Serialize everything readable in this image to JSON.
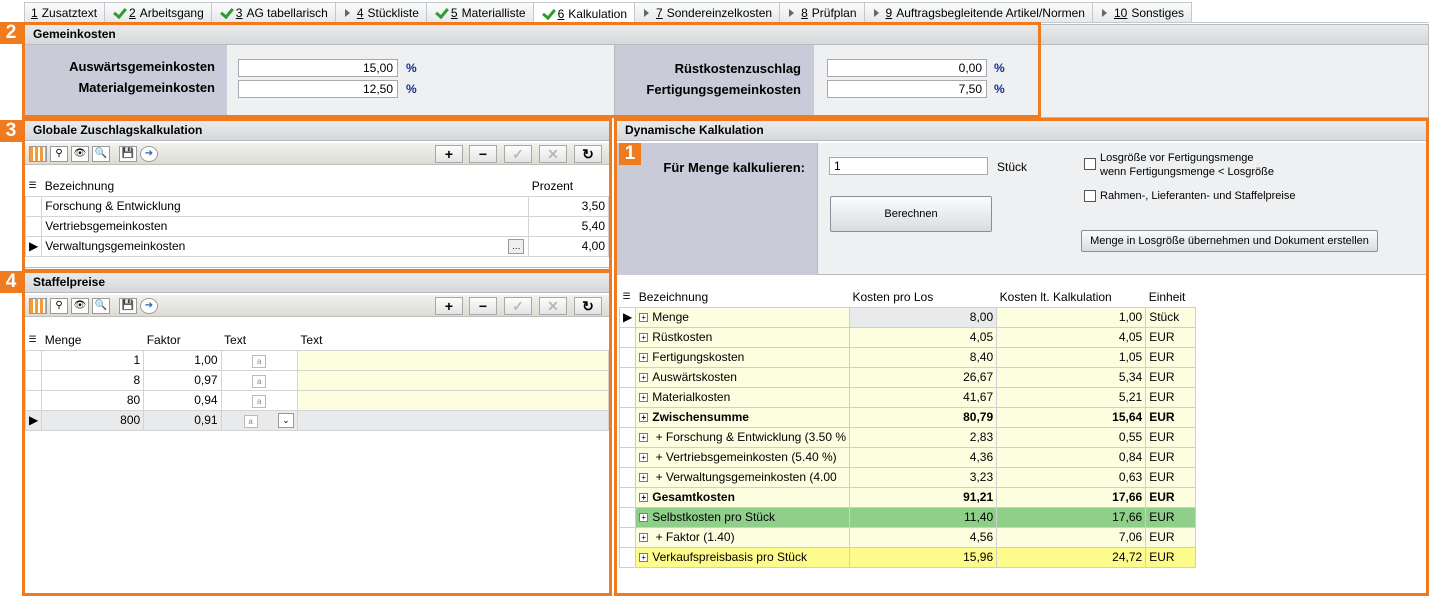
{
  "tabs": [
    {
      "num": "1",
      "label": "Zusatztext",
      "icon": "none"
    },
    {
      "num": "2",
      "label": "Arbeitsgang",
      "icon": "check"
    },
    {
      "num": "3",
      "label": "AG tabellarisch",
      "icon": "check"
    },
    {
      "num": "4",
      "label": "Stückliste",
      "icon": "arrow"
    },
    {
      "num": "5",
      "label": "Materialliste",
      "icon": "check"
    },
    {
      "num": "6",
      "label": "Kalkulation",
      "icon": "check",
      "active": true
    },
    {
      "num": "7",
      "label": "Sondereinzelkosten",
      "icon": "arrow"
    },
    {
      "num": "8",
      "label": "Prüfplan",
      "icon": "arrow"
    },
    {
      "num": "9",
      "label": "Auftragsbegleitende Artikel/Normen",
      "icon": "arrow"
    },
    {
      "num": "10",
      "label": "Sonstiges",
      "icon": "arrow"
    }
  ],
  "badges": {
    "b1": "1",
    "b2": "2",
    "b3": "3",
    "b4": "4"
  },
  "gemein": {
    "title": "Gemeinkosten",
    "ausw_label": "Auswärtsgemeinkosten",
    "ausw_value": "15,00",
    "mat_label": "Materialgemeinkosten",
    "mat_value": "12,50",
    "ruest_label": "Rüstkostenzuschlag",
    "ruest_value": "0,00",
    "fert_label": "Fertigungsgemeinkosten",
    "fert_value": "7,50",
    "pct": "%"
  },
  "globale": {
    "title": "Globale Zuschlagskalkulation",
    "col_bez": "Bezeichnung",
    "col_proz": "Prozent",
    "rows": [
      {
        "bez": "Forschung & Entwicklung",
        "proz": "3,50"
      },
      {
        "bez": "Vertriebsgemeinkosten",
        "proz": "5,40"
      },
      {
        "bez": "Verwaltungsgemeinkosten",
        "proz": "4,00"
      }
    ],
    "ellipsis": "…"
  },
  "staffel": {
    "title": "Staffelpreise",
    "col_menge": "Menge",
    "col_faktor": "Faktor",
    "col_text1": "Text",
    "col_text2": "Text",
    "rows": [
      {
        "menge": "1",
        "faktor": "1,00"
      },
      {
        "menge": "8",
        "faktor": "0,97"
      },
      {
        "menge": "80",
        "faktor": "0,94"
      },
      {
        "menge": "800",
        "faktor": "0,91"
      }
    ]
  },
  "toolbar": {
    "plus": "+",
    "minus": "−",
    "ok": "✓",
    "cancel": "✕",
    "refresh": "↻"
  },
  "dyn": {
    "title": "Dynamische Kalkulation",
    "menge_label": "Für Menge kalkulieren:",
    "menge_value": "1",
    "unit": "Stück",
    "cb1_line1": "Losgröße vor Fertigungsmenge",
    "cb1_line2": "wenn Fertigungsmenge < Losgröße",
    "cb2": "Rahmen-, Lieferanten- und Staffelpreise",
    "btn_berechnen": "Berechnen",
    "btn_menge": "Menge in Losgröße übernehmen und Dokument erstellen"
  },
  "kalk": {
    "col_bez": "Bezeichnung",
    "col_los": "Kosten pro Los",
    "col_kalk": "Kosten lt. Kalkulation",
    "col_einheit": "Einheit",
    "rows": [
      {
        "bez": "Menge",
        "los": "8,00",
        "kalk": "1,00",
        "einheit": "Stück",
        "style": "menge"
      },
      {
        "bez": "Rüstkosten",
        "los": "4,05",
        "kalk": "4,05",
        "einheit": "EUR",
        "style": ""
      },
      {
        "bez": "Fertigungskosten",
        "los": "8,40",
        "kalk": "1,05",
        "einheit": "EUR",
        "style": ""
      },
      {
        "bez": "Auswärtskosten",
        "los": "26,67",
        "kalk": "5,34",
        "einheit": "EUR",
        "style": ""
      },
      {
        "bez": "Materialkosten",
        "los": "41,67",
        "kalk": "5,21",
        "einheit": "EUR",
        "style": ""
      },
      {
        "bez": "Zwischensumme",
        "los": "80,79",
        "kalk": "15,64",
        "einheit": "EUR",
        "style": "bold"
      },
      {
        "bez": " + Forschung & Entwicklung (3.50 %",
        "los": "2,83",
        "kalk": "0,55",
        "einheit": "EUR",
        "style": ""
      },
      {
        "bez": " + Vertriebsgemeinkosten (5.40 %)",
        "los": "4,36",
        "kalk": "0,84",
        "einheit": "EUR",
        "style": ""
      },
      {
        "bez": " + Verwaltungsgemeinkosten (4.00",
        "los": "3,23",
        "kalk": "0,63",
        "einheit": "EUR",
        "style": ""
      },
      {
        "bez": "Gesamtkosten",
        "los": "91,21",
        "kalk": "17,66",
        "einheit": "EUR",
        "style": "bold"
      },
      {
        "bez": "Selbstkosten pro Stück",
        "los": "11,40",
        "kalk": "17,66",
        "einheit": "EUR",
        "style": "green"
      },
      {
        "bez": " + Faktor (1.40)",
        "los": "4,56",
        "kalk": "7,06",
        "einheit": "EUR",
        "style": ""
      },
      {
        "bez": "Verkaufspreisbasis pro Stück",
        "los": "15,96",
        "kalk": "24,72",
        "einheit": "EUR",
        "style": "yellow"
      }
    ]
  }
}
